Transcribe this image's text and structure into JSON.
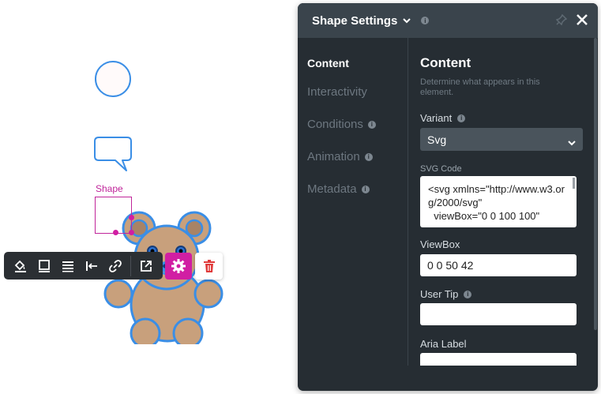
{
  "canvas": {
    "shape_label": "Shape"
  },
  "toolbar": {
    "icons": [
      "fill-icon",
      "border-icon",
      "align-icon",
      "align-left-icon",
      "link-icon",
      "external-link-icon",
      "gear-icon",
      "trash-icon"
    ],
    "accent": "#d11ea3"
  },
  "panel": {
    "title": "Shape Settings",
    "nav": {
      "content": "Content",
      "interactivity": "Interactivity",
      "conditions": "Conditions",
      "animation": "Animation",
      "metadata": "Metadata"
    },
    "content": {
      "heading": "Content",
      "description": "Determine what appears in this element.",
      "variant_label": "Variant",
      "variant_value": "Svg",
      "svg_code_label": "SVG Code",
      "svg_code_value": "<svg xmlns=\"http://www.w3.org/2000/svg\"\n  viewBox=\"0 0 100 100\"",
      "viewbox_label": "ViewBox",
      "viewbox_value": "0 0 50 42",
      "user_tip_label": "User Tip",
      "user_tip_value": "",
      "aria_label_label": "Aria Label",
      "aria_label_value": ""
    }
  },
  "colors": {
    "panel_bg": "#262d33",
    "header_bg": "#3a444c",
    "shape_stroke": "#3a8ee6",
    "bear_fill": "#c8a07c"
  }
}
